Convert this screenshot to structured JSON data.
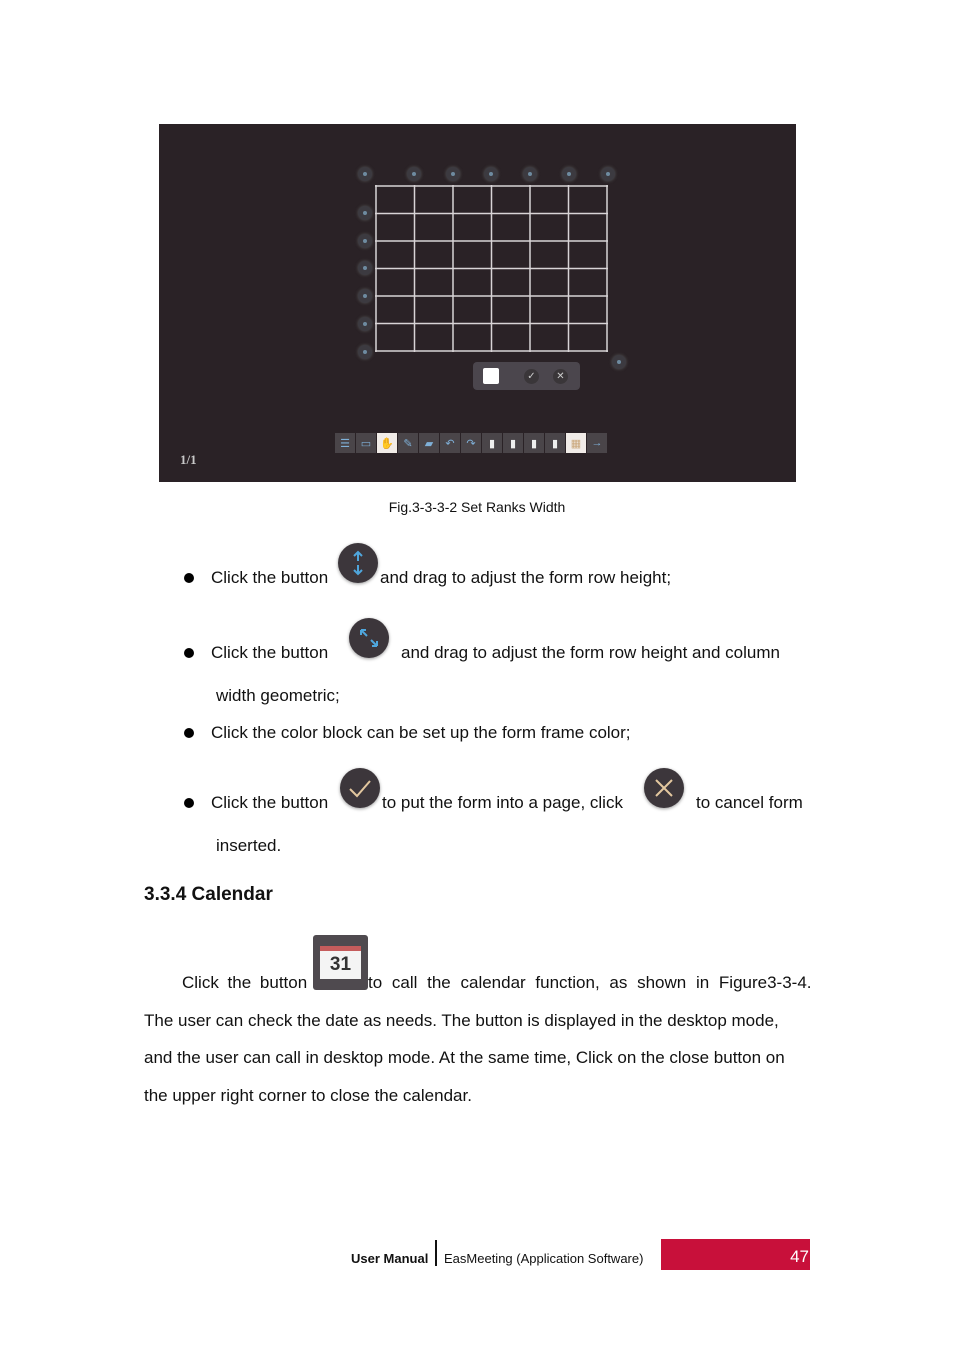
{
  "figure": {
    "grid_rows": 6,
    "grid_cols": 6,
    "page_indicator": "1/1",
    "form_bar": {
      "swatch_color": "#ffffff",
      "confirm_icon": "check-icon",
      "cancel_icon": "close-icon"
    },
    "toolbar_icons": [
      "menu-icon",
      "desktop-icon",
      "select-hand-icon",
      "pen-icon",
      "eraser-icon",
      "undo-icon",
      "redo-icon",
      "page-icon",
      "page-icon",
      "page-icon",
      "page-icon",
      "table-icon",
      "next-icon"
    ],
    "caption": "Fig.3-3-3-2 Set Ranks Width"
  },
  "bullets": [
    {
      "before": "Click the button",
      "icon": "row-height-arrows-icon",
      "after": "and drag to adjust the form row height;"
    },
    {
      "before": "Click the button",
      "icon": "diagonal-resize-icon",
      "after": "and drag to adjust the form row height and column",
      "cont": "width geometric;"
    },
    {
      "text": "Click the color block can be set up the form frame color;"
    },
    {
      "before": "Click the button",
      "icon1": "check-icon",
      "middle": "to put the form into a page, click",
      "icon2": "close-icon",
      "after": "to cancel form",
      "cont": "inserted."
    }
  ],
  "section": {
    "title": "3.3.4 Calendar"
  },
  "paragraph": {
    "line1_a": "Click the button",
    "calendar_number": "31",
    "line1_b": "to call the calendar function, as shown in Figure3-3-4.",
    "line2": "The user can check the date as needs. The button is displayed in the desktop mode,",
    "line3": "and the user can call in desktop mode. At the same time, Click on the close button on",
    "line4": "the upper right corner to close the calendar."
  },
  "footer": {
    "left": "User Manual",
    "middle": "EasMeeting (Application Software)",
    "page": "47",
    "accent": "#c8103a"
  }
}
